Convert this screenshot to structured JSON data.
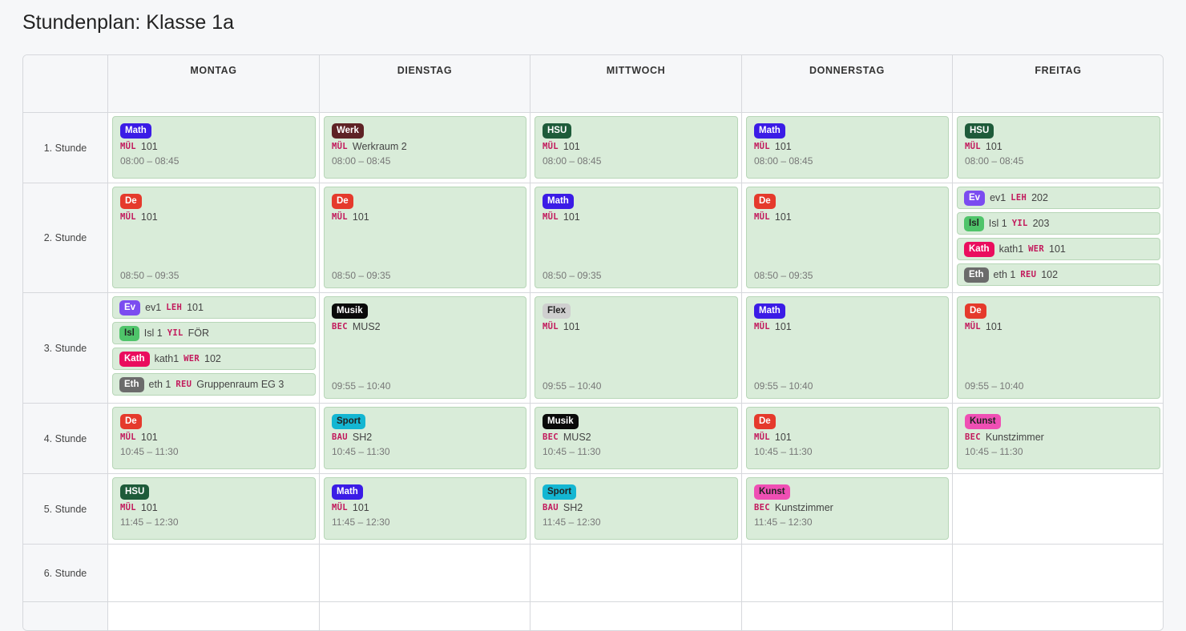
{
  "title": "Stundenplan: Klasse 1a",
  "days": [
    "MONTAG",
    "DIENSTAG",
    "MITTWOCH",
    "DONNERSTAG",
    "FREITAG"
  ],
  "periods": [
    "1. Stunde",
    "2. Stunde",
    "3. Stunde",
    "4. Stunde",
    "5. Stunde",
    "6. Stunde"
  ],
  "subject_colors": {
    "Math": "#3b1ce6",
    "Werk": "#5e2225",
    "HSU": "#1e5b3a",
    "De": "#e53a2c",
    "Ev": "#7b4cf0",
    "Isl": "#4fc46a",
    "Kath": "#ea0d5e",
    "Eth": "#6b6b6b",
    "Musik": "#0a0a0a",
    "Flex": "#cfcfcf",
    "Sport": "#14b6d2",
    "Kunst": "#ef4fb4"
  },
  "grid": [
    [
      {
        "type": "lesson",
        "subject": "Math",
        "teacher": "MÜL",
        "room": "101",
        "time": "08:00 – 08:45"
      },
      {
        "type": "lesson",
        "subject": "Werk",
        "teacher": "MÜL",
        "room": "Werkraum 2",
        "time": "08:00 – 08:45"
      },
      {
        "type": "lesson",
        "subject": "HSU",
        "teacher": "MÜL",
        "room": "101",
        "time": "08:00 – 08:45"
      },
      {
        "type": "lesson",
        "subject": "Math",
        "teacher": "MÜL",
        "room": "101",
        "time": "08:00 – 08:45"
      },
      {
        "type": "lesson",
        "subject": "HSU",
        "teacher": "MÜL",
        "room": "101",
        "time": "08:00 – 08:45"
      }
    ],
    [
      {
        "type": "lesson",
        "subject": "De",
        "teacher": "MÜL",
        "room": "101",
        "time": "08:50 – 09:35"
      },
      {
        "type": "lesson",
        "subject": "De",
        "teacher": "MÜL",
        "room": "101",
        "time": "08:50 – 09:35"
      },
      {
        "type": "lesson",
        "subject": "Math",
        "teacher": "MÜL",
        "room": "101",
        "time": "08:50 – 09:35"
      },
      {
        "type": "lesson",
        "subject": "De",
        "teacher": "MÜL",
        "room": "101",
        "time": "08:50 – 09:35"
      },
      {
        "type": "groups",
        "groups": [
          {
            "subject": "Ev",
            "group": "ev1",
            "teacher": "LEH",
            "room": "202"
          },
          {
            "subject": "Isl",
            "group": "Isl 1",
            "teacher": "YIL",
            "room": "203"
          },
          {
            "subject": "Kath",
            "group": "kath1",
            "teacher": "WER",
            "room": "101"
          },
          {
            "subject": "Eth",
            "group": "eth 1",
            "teacher": "REU",
            "room": "102"
          }
        ]
      }
    ],
    [
      {
        "type": "groups",
        "groups": [
          {
            "subject": "Ev",
            "group": "ev1",
            "teacher": "LEH",
            "room": "101"
          },
          {
            "subject": "Isl",
            "group": "Isl 1",
            "teacher": "YIL",
            "room": "FÖR"
          },
          {
            "subject": "Kath",
            "group": "kath1",
            "teacher": "WER",
            "room": "102"
          },
          {
            "subject": "Eth",
            "group": "eth 1",
            "teacher": "REU",
            "room": "Gruppenraum EG 3"
          }
        ]
      },
      {
        "type": "lesson",
        "subject": "Musik",
        "teacher": "BEC",
        "room": "MUS2",
        "time": "09:55 – 10:40"
      },
      {
        "type": "lesson",
        "subject": "Flex",
        "teacher": "MÜL",
        "room": "101",
        "time": "09:55 – 10:40"
      },
      {
        "type": "lesson",
        "subject": "Math",
        "teacher": "MÜL",
        "room": "101",
        "time": "09:55 – 10:40"
      },
      {
        "type": "lesson",
        "subject": "De",
        "teacher": "MÜL",
        "room": "101",
        "time": "09:55 – 10:40"
      }
    ],
    [
      {
        "type": "lesson",
        "subject": "De",
        "teacher": "MÜL",
        "room": "101",
        "time": "10:45 – 11:30"
      },
      {
        "type": "lesson",
        "subject": "Sport",
        "teacher": "BAU",
        "room": "SH2",
        "time": "10:45 – 11:30"
      },
      {
        "type": "lesson",
        "subject": "Musik",
        "teacher": "BEC",
        "room": "MUS2",
        "time": "10:45 – 11:30"
      },
      {
        "type": "lesson",
        "subject": "De",
        "teacher": "MÜL",
        "room": "101",
        "time": "10:45 – 11:30"
      },
      {
        "type": "lesson",
        "subject": "Kunst",
        "teacher": "BEC",
        "room": "Kunstzimmer",
        "time": "10:45 – 11:30"
      }
    ],
    [
      {
        "type": "lesson",
        "subject": "HSU",
        "teacher": "MÜL",
        "room": "101",
        "time": "11:45 – 12:30"
      },
      {
        "type": "lesson",
        "subject": "Math",
        "teacher": "MÜL",
        "room": "101",
        "time": "11:45 – 12:30"
      },
      {
        "type": "lesson",
        "subject": "Sport",
        "teacher": "BAU",
        "room": "SH2",
        "time": "11:45 – 12:30"
      },
      {
        "type": "lesson",
        "subject": "Kunst",
        "teacher": "BEC",
        "room": "Kunstzimmer",
        "time": "11:45 – 12:30"
      },
      {
        "type": "empty"
      }
    ],
    [
      {
        "type": "empty"
      },
      {
        "type": "empty"
      },
      {
        "type": "empty"
      },
      {
        "type": "empty"
      },
      {
        "type": "empty"
      }
    ],
    [
      {
        "type": "empty"
      },
      {
        "type": "empty"
      },
      {
        "type": "empty"
      },
      {
        "type": "empty"
      },
      {
        "type": "empty"
      }
    ]
  ]
}
